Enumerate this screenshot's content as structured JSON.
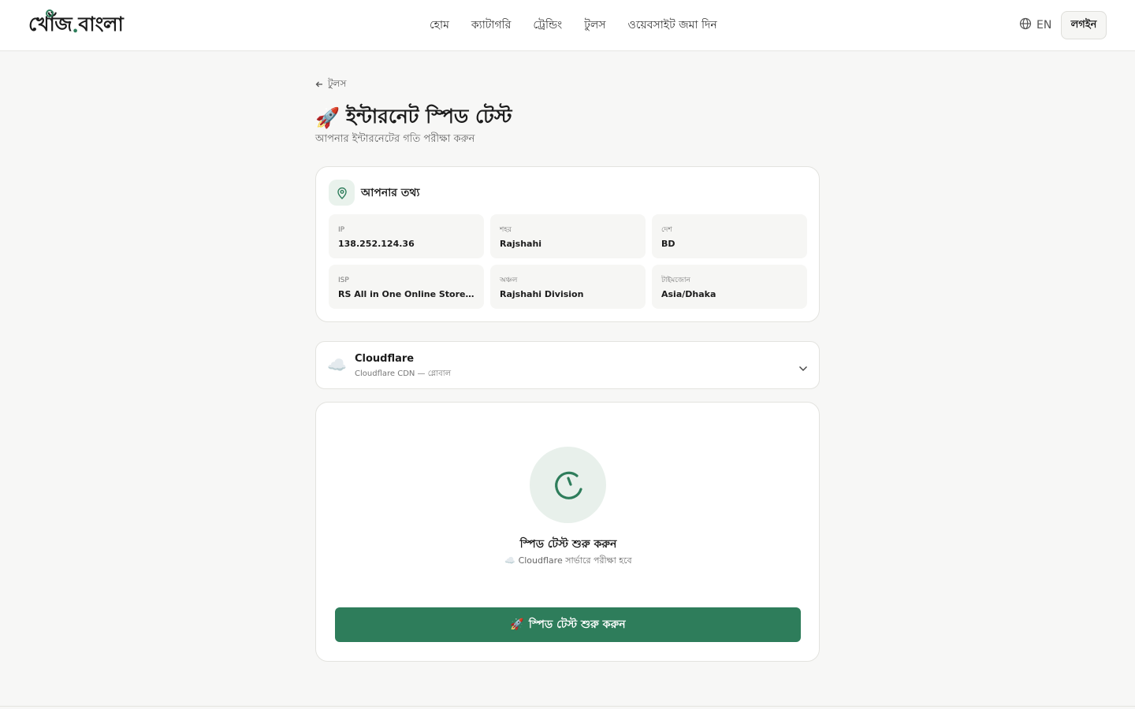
{
  "header": {
    "logo_main": "খোঁজ",
    "logo_dot": ".",
    "logo_tail": "বাংলা",
    "nav": [
      "হোম",
      "ক্যাটাগরি",
      "ট্রেন্ডিং",
      "টুলস",
      "ওয়েবসাইট জমা দিন"
    ],
    "lang_label": "EN",
    "login_label": "লগইন"
  },
  "page": {
    "back_label": "টুলস",
    "title_icon": "🚀",
    "title": "ইন্টারনেট স্পিড টেস্ট",
    "subtitle": "আপনার ইন্টারনেটের গতি পরীক্ষা করুন"
  },
  "info": {
    "title": "আপনার তথ্য",
    "fields": [
      {
        "label": "IP",
        "value": "138.252.124.36"
      },
      {
        "label": "শহর",
        "value": "Rajshahi"
      },
      {
        "label": "দেশ",
        "value": "BD"
      },
      {
        "label": "ISP",
        "value": "RS All in One Online Store Rajshahi"
      },
      {
        "label": "অঞ্চল",
        "value": "Rajshahi Division"
      },
      {
        "label": "টাইমজোন",
        "value": "Asia/Dhaka"
      }
    ]
  },
  "server": {
    "icon": "☁️",
    "name": "Cloudflare",
    "description": "Cloudflare CDN — গ্লোবাল"
  },
  "speed": {
    "heading": "স্পিড টেস্ট শুরু করুন",
    "note": "☁️ Cloudflare সার্ভারে পরীক্ষা হবে",
    "button_icon": "🚀",
    "button_label": "স্পিড টেস্ট শুরু করুন"
  },
  "colors": {
    "accent": "#2e7d5b",
    "accent_light": "#e8f0eb",
    "background": "#f7f7f6"
  },
  "icons": {
    "language": "globe-icon",
    "back": "arrow-left-icon",
    "location": "map-pin-icon",
    "dropdown": "chevron-down-icon",
    "gauge": "speedometer-icon"
  }
}
